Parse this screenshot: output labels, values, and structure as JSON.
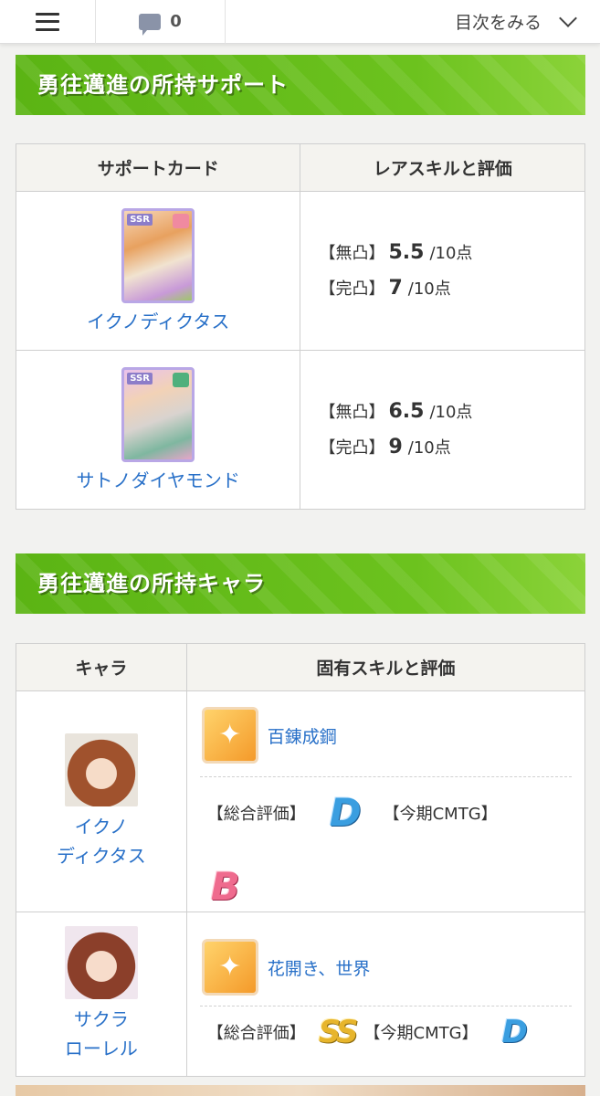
{
  "topbar": {
    "comment_count": "0",
    "toc_label": "目次をみる"
  },
  "support_section": {
    "title": "勇往邁進の所持サポート",
    "headers": [
      "サポートカード",
      "レアスキルと評価"
    ],
    "rows": [
      {
        "card_badge": "SSR",
        "card_name": "イクノディクタス",
        "line1_label": "【無凸】",
        "line1_value": "5.5",
        "line1_unit": "/10点",
        "line2_label": "【完凸】",
        "line2_value": "7",
        "line2_unit": "/10点"
      },
      {
        "card_badge": "SSR",
        "card_name": "サトノダイヤモンド",
        "line1_label": "【無凸】",
        "line1_value": "6.5",
        "line1_unit": "/10点",
        "line2_label": "【完凸】",
        "line2_value": "9",
        "line2_unit": "/10点"
      }
    ]
  },
  "chara_section": {
    "title": "勇往邁進の所持キャラ",
    "headers": [
      "キャラ",
      "固有スキルと評価"
    ],
    "rows": [
      {
        "name_line1": "イクノ",
        "name_line2": "ディクタス",
        "skill_name": "百錬成鋼",
        "overall_label": "【総合評価】",
        "overall_grade": "D",
        "cmtg_label": "【今期CMTG】",
        "cmtg_grade": "B"
      },
      {
        "name_line1": "サクラ",
        "name_line2": "ローレル",
        "skill_name": "花開き、世界",
        "overall_label": "【総合評価】",
        "overall_grade": "SS",
        "cmtg_label": "【今期CMTG】",
        "cmtg_grade": "D"
      }
    ]
  },
  "colors": {
    "banner_green": "#6cc21e",
    "link_blue": "#2870c8",
    "grade_d": "#3a9ee0",
    "grade_b": "#ef6b8e",
    "grade_ss": "#e7b52c"
  }
}
